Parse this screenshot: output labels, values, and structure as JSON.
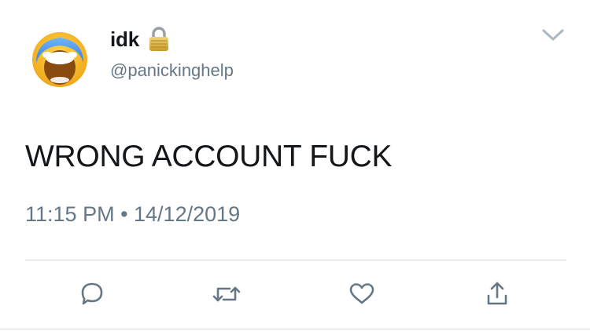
{
  "tweet": {
    "display_name": "idk",
    "handle": "@panickinghelp",
    "text": "WRONG ACCOUNT FUCK",
    "timestamp": "11:15 PM • 14/12/2019"
  },
  "icons": {
    "avatar": "face-screaming-emoji",
    "protected": "lock-icon",
    "menu": "chevron-down-icon",
    "actions": [
      "reply-icon",
      "retweet-icon",
      "like-icon",
      "share-icon"
    ]
  },
  "colors": {
    "text": "#14171a",
    "secondary_text": "#657786",
    "action_icon": "#657786",
    "divider": "#c9cfd4"
  }
}
